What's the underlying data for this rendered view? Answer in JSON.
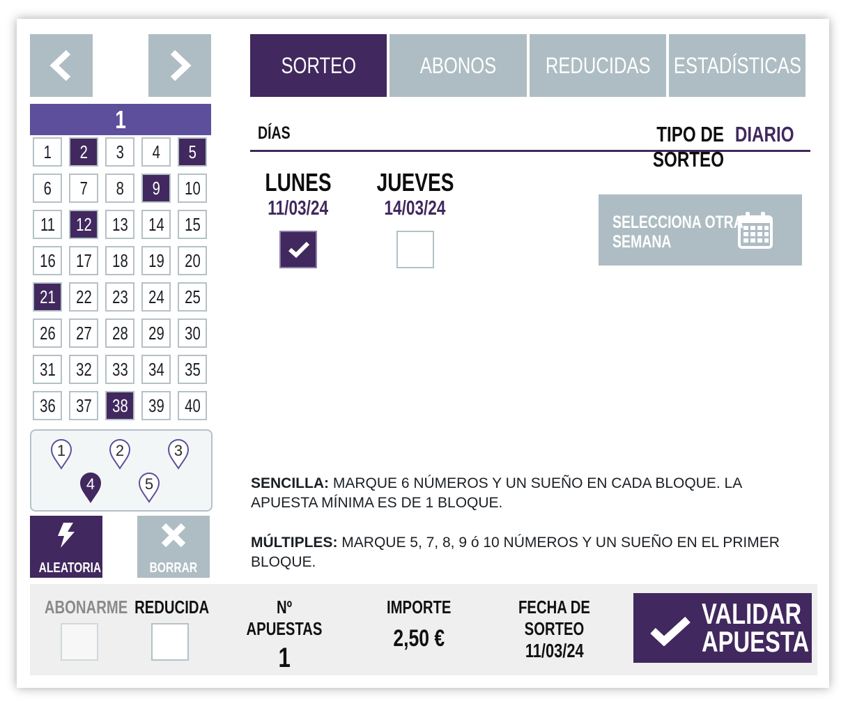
{
  "nav": {
    "prev_icon": "chevron-left-icon",
    "next_icon": "chevron-right-icon"
  },
  "tabs": [
    {
      "label": "SORTEO",
      "active": true
    },
    {
      "label": "ABONOS",
      "active": false
    },
    {
      "label": "REDUCIDAS",
      "active": false
    },
    {
      "label": "ESTADÍSTICAS",
      "active": false
    }
  ],
  "block": {
    "title": "1"
  },
  "numbers": [
    "1",
    "2",
    "3",
    "4",
    "5",
    "6",
    "7",
    "8",
    "9",
    "10",
    "11",
    "12",
    "13",
    "14",
    "15",
    "16",
    "17",
    "18",
    "19",
    "20",
    "21",
    "22",
    "23",
    "24",
    "25",
    "26",
    "27",
    "28",
    "29",
    "30",
    "31",
    "32",
    "33",
    "34",
    "35",
    "36",
    "37",
    "38",
    "39",
    "40"
  ],
  "selected_numbers": [
    2,
    5,
    9,
    12,
    21,
    38
  ],
  "dreams": {
    "values": [
      "1",
      "2",
      "3",
      "4",
      "5"
    ],
    "selected": "4"
  },
  "actions": {
    "random_label": "ALEATORIA",
    "clear_label": "BORRAR"
  },
  "draw": {
    "days_label": "DÍAS",
    "type_label": "TIPO DE SORTEO",
    "type_value": "DIARIO",
    "days": [
      {
        "name": "LUNES",
        "date": "11/03/24",
        "checked": true
      },
      {
        "name": "JUEVES",
        "date": "14/03/24",
        "checked": false
      }
    ],
    "week_button": {
      "line1": "SELECCIONA OTRA",
      "line2": "SEMANA",
      "icon": "calendar-icon"
    }
  },
  "info": {
    "simple_title": "SENCILLA:",
    "simple_text": " MARQUE 6 NÚMEROS Y UN SUEÑO EN CADA BLOQUE. LA APUESTA MÍNIMA ES DE 1 BLOQUE.",
    "multiple_title": "MÚLTIPLES:",
    "multiple_text": " MARQUE 5, 7, 8, 9 ó 10 NÚMEROS Y UN SUEÑO EN EL PRIMER BLOQUE."
  },
  "footer": {
    "subscribe_label": "ABONARME",
    "reduced_label": "REDUCIDA",
    "bets_label": "Nº APUESTAS",
    "bets_value": "1",
    "amount_label": "IMPORTE",
    "amount_value": "2,50 €",
    "date_label": "FECHA DE SORTEO",
    "date_value": "11/03/24",
    "validate_line1": "VALIDAR",
    "validate_line2": "APUESTA"
  },
  "colors": {
    "accent": "#41285e",
    "block_header": "#5d4f9b",
    "inactive": "#aebdc3",
    "footer_bg": "#efefef"
  }
}
